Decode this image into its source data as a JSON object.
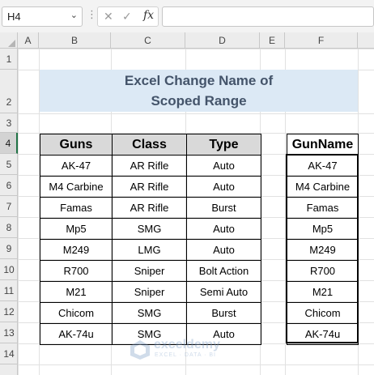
{
  "formula_bar": {
    "name_box": "H4",
    "chevron": "⌄",
    "dots": "⋮",
    "cancel_icon": "✕",
    "enter_icon": "✓",
    "fx_label": "fx",
    "formula": ""
  },
  "columns": [
    "A",
    "B",
    "C",
    "D",
    "E",
    "F"
  ],
  "rows": [
    "1",
    "2",
    "3",
    "4",
    "5",
    "6",
    "7",
    "8",
    "9",
    "10",
    "11",
    "12",
    "13",
    "14"
  ],
  "selected_cell": "H4",
  "title": {
    "line1": "Excel Change Name of",
    "line2": "Scoped Range"
  },
  "main_table": {
    "headers": [
      "Guns",
      "Class",
      "Type"
    ],
    "rows": [
      [
        "AK-47",
        "AR Rifle",
        "Auto"
      ],
      [
        "M4 Carbine",
        "AR Rifle",
        "Auto"
      ],
      [
        "Famas",
        "AR Rifle",
        "Burst"
      ],
      [
        "Mp5",
        "SMG",
        "Auto"
      ],
      [
        "M249",
        "LMG",
        "Auto"
      ],
      [
        "R700",
        "Sniper",
        "Bolt Action"
      ],
      [
        "M21",
        "Sniper",
        "Semi Auto"
      ],
      [
        "Chicom",
        "SMG",
        "Burst"
      ],
      [
        "AK-74u",
        "SMG",
        "Auto"
      ]
    ]
  },
  "gun_table": {
    "header": "GunName",
    "values": [
      "AK-47",
      "M4 Carbine",
      "Famas",
      "Mp5",
      "M249",
      "R700",
      "M21",
      "Chicom",
      "AK-74u"
    ]
  },
  "watermark": {
    "name": "exceldemy",
    "tagline": "EXCEL · DATA · BI"
  }
}
